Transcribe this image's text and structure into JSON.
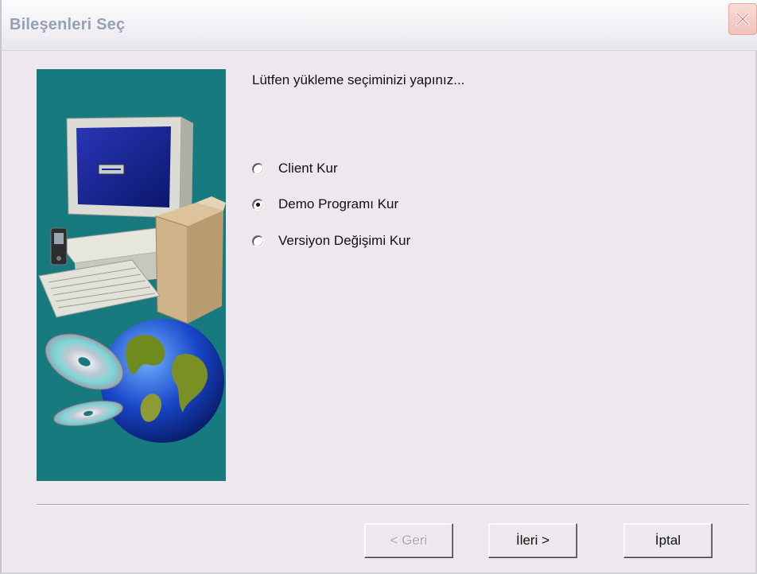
{
  "window": {
    "title": "Bileşenleri Seç"
  },
  "content": {
    "prompt": "Lütfen yükleme seçiminizi yapınız...",
    "options": [
      {
        "label": "Client Kur",
        "checked": false
      },
      {
        "label": "Demo Programı Kur",
        "checked": true
      },
      {
        "label": "Versiyon Değişimi Kur",
        "checked": false
      }
    ]
  },
  "buttons": {
    "back_label": "< Geri",
    "next_label": "İleri >",
    "cancel_label": "İptal"
  },
  "colors": {
    "side_panel": "#177a7e",
    "dialog_background": "#ece8ee",
    "title_text": "#97a1b5"
  }
}
